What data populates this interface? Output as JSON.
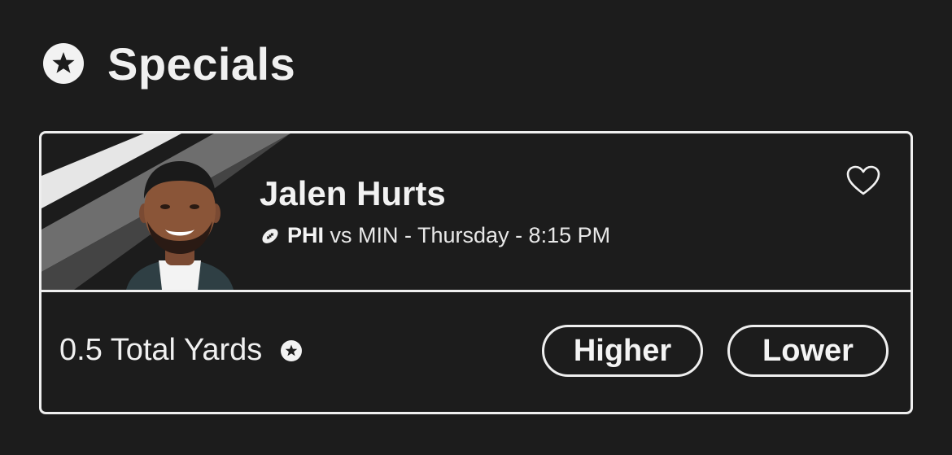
{
  "section": {
    "title": "Specials",
    "icon": "star-circle-icon"
  },
  "card": {
    "player_name": "Jalen Hurts",
    "sport_icon": "football-icon",
    "team": "PHI",
    "vs_text": " vs MIN - Thursday - 8:15 PM",
    "favorite_icon": "heart-outline-icon",
    "stat_line": "0.5 Total Yards",
    "stat_icon": "star-circle-icon",
    "higher_label": "Higher",
    "lower_label": "Lower"
  },
  "colors": {
    "background": "#1c1c1c",
    "border": "#efefef",
    "text": "#f2f2f2",
    "stripe_light": "#e6e6e6",
    "stripe_mid": "#6e6e6e",
    "stripe_dark": "#444444"
  }
}
